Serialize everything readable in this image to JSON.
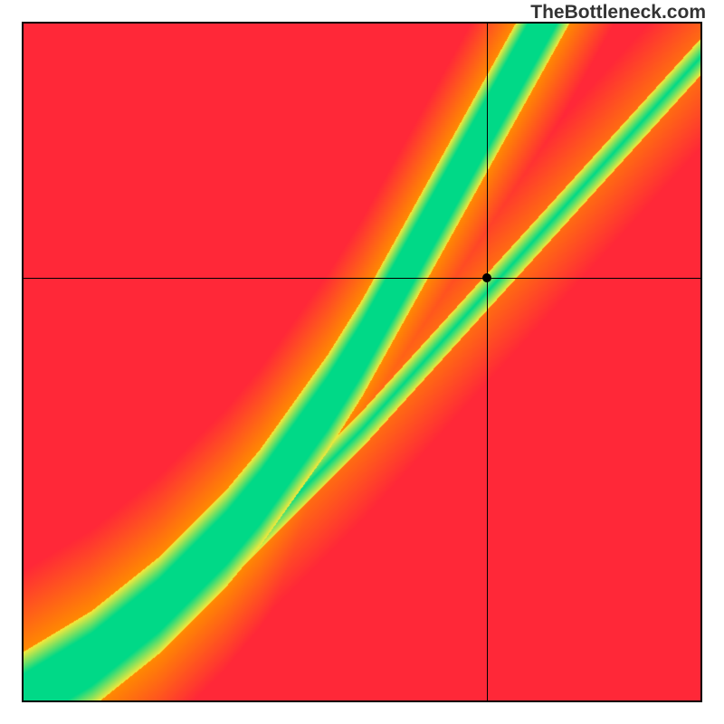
{
  "watermark": "TheBottleneck.com",
  "chart_data": {
    "type": "heatmap",
    "title": "",
    "xlabel": "",
    "ylabel": "",
    "xlim": [
      0,
      1
    ],
    "ylim": [
      0,
      1
    ],
    "crosshair": {
      "x": 0.685,
      "y": 0.625
    },
    "marker": {
      "x": 0.685,
      "y": 0.625
    },
    "optimal_curve": [
      {
        "x": 0.0,
        "y": 0.0
      },
      {
        "x": 0.05,
        "y": 0.03
      },
      {
        "x": 0.1,
        "y": 0.06
      },
      {
        "x": 0.15,
        "y": 0.1
      },
      {
        "x": 0.2,
        "y": 0.14
      },
      {
        "x": 0.25,
        "y": 0.19
      },
      {
        "x": 0.3,
        "y": 0.24
      },
      {
        "x": 0.35,
        "y": 0.3
      },
      {
        "x": 0.4,
        "y": 0.37
      },
      {
        "x": 0.45,
        "y": 0.44
      },
      {
        "x": 0.5,
        "y": 0.52
      },
      {
        "x": 0.55,
        "y": 0.61
      },
      {
        "x": 0.6,
        "y": 0.7
      },
      {
        "x": 0.65,
        "y": 0.79
      },
      {
        "x": 0.7,
        "y": 0.88
      },
      {
        "x": 0.75,
        "y": 0.97
      },
      {
        "x": 0.8,
        "y": 1.06
      }
    ],
    "secondary_band": [
      {
        "x": 0.0,
        "y": 0.0
      },
      {
        "x": 0.1,
        "y": 0.05
      },
      {
        "x": 0.2,
        "y": 0.12
      },
      {
        "x": 0.3,
        "y": 0.2
      },
      {
        "x": 0.4,
        "y": 0.3
      },
      {
        "x": 0.5,
        "y": 0.4
      },
      {
        "x": 0.6,
        "y": 0.51
      },
      {
        "x": 0.7,
        "y": 0.62
      },
      {
        "x": 0.8,
        "y": 0.73
      },
      {
        "x": 0.9,
        "y": 0.84
      },
      {
        "x": 1.0,
        "y": 0.95
      }
    ],
    "band_width_main": 0.055,
    "band_width_secondary": 0.03,
    "colors": {
      "optimal": "#00d987",
      "good": "#f7e93a",
      "moderate": "#ff8c00",
      "poor": "#ff2838"
    }
  }
}
